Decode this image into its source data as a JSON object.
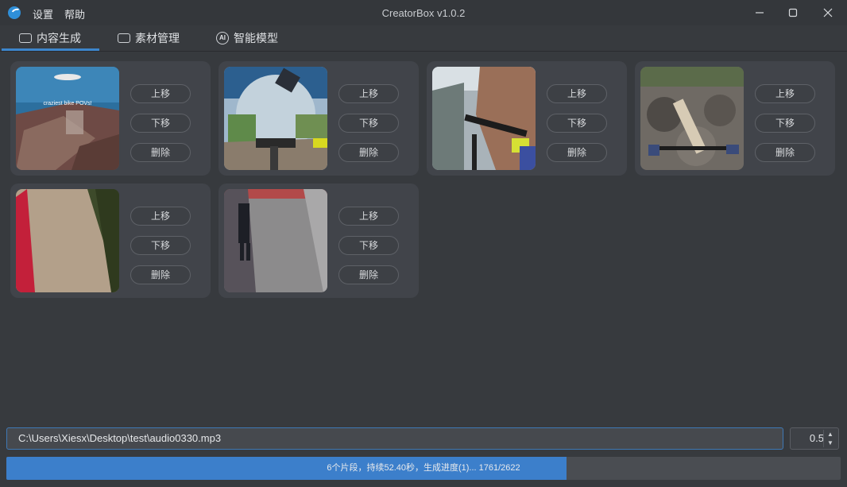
{
  "window": {
    "title": "CreatorBox v1.0.2"
  },
  "menu": {
    "settings": "设置",
    "help": "帮助"
  },
  "tabs": [
    {
      "label": "内容生成",
      "active": true
    },
    {
      "label": "素材管理",
      "active": false
    },
    {
      "label": "智能模型",
      "active": false
    }
  ],
  "clips": [
    {
      "caption": "craziest bike POVs!",
      "up": "上移",
      "down": "下移",
      "delete": "删除"
    },
    {
      "up": "上移",
      "down": "下移",
      "delete": "删除"
    },
    {
      "up": "上移",
      "down": "下移",
      "delete": "删除"
    },
    {
      "up": "上移",
      "down": "下移",
      "delete": "删除"
    },
    {
      "up": "上移",
      "down": "下移",
      "delete": "删除"
    },
    {
      "up": "上移",
      "down": "下移",
      "delete": "删除"
    }
  ],
  "audio_path": "C:\\Users\\Xiesx\\Desktop\\test\\audio0330.mp3",
  "spin_value": "0.5",
  "progress": {
    "text": "6个片段，持续52.40秒，生成进度(1)... 1761/2622",
    "done": 1761,
    "total": 2622
  },
  "colors": {
    "accent": "#3c86cc",
    "progress": "#3c7fcb",
    "background": "#373a3e",
    "card": "#41444a"
  }
}
